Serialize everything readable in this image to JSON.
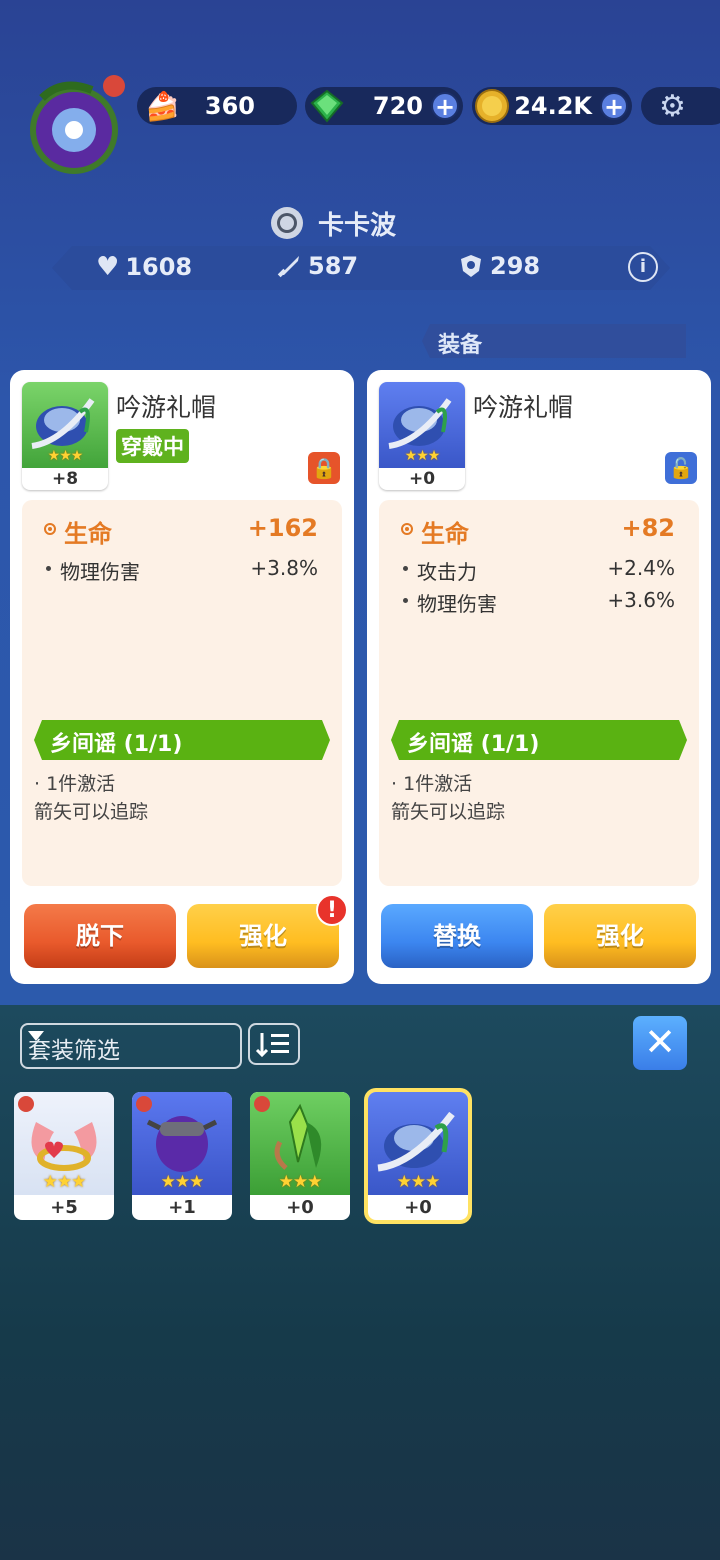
{
  "currency": {
    "cake": "360",
    "gems": "720",
    "coins": "24.2K"
  },
  "player": {
    "name": "卡卡波"
  },
  "stats": {
    "hp": "1608",
    "attack": "587",
    "defense": "298"
  },
  "tab": "装备",
  "left_card": {
    "name": "吟游礼帽",
    "badge": "穿戴中",
    "level": "+8",
    "main_stat": {
      "name": "生命",
      "value": "+162"
    },
    "sub_stats": [
      {
        "name": "物理伤害",
        "value": "+3.8%"
      }
    ],
    "set_name": "乡间谣 (1/1)",
    "set_line1": "· 1件激活",
    "set_line2": "箭矢可以追踪",
    "btn_left": "脱下",
    "btn_right": "强化"
  },
  "right_card": {
    "name": "吟游礼帽",
    "level": "+0",
    "main_stat": {
      "name": "生命",
      "value": "+82"
    },
    "sub_stats": [
      {
        "name": "攻击力",
        "value": "+2.4%"
      },
      {
        "name": "物理伤害",
        "value": "+3.6%"
      }
    ],
    "set_name": "乡间谣 (1/1)",
    "set_line1": "· 1件激活",
    "set_line2": "箭矢可以追踪",
    "btn_left": "替换",
    "btn_right": "强化"
  },
  "filter": {
    "label": "套装筛选"
  },
  "inventory": [
    {
      "item": "pink-wings-ring",
      "level": "+5"
    },
    {
      "item": "purple-helmet",
      "level": "+1"
    },
    {
      "item": "green-leaf-shard",
      "level": "+0"
    },
    {
      "item": "bard-hat",
      "level": "+0"
    }
  ],
  "colors": {
    "accent_orange": "#e47a24",
    "set_green": "#5ab212",
    "wearing_green": "#5fb21e"
  }
}
